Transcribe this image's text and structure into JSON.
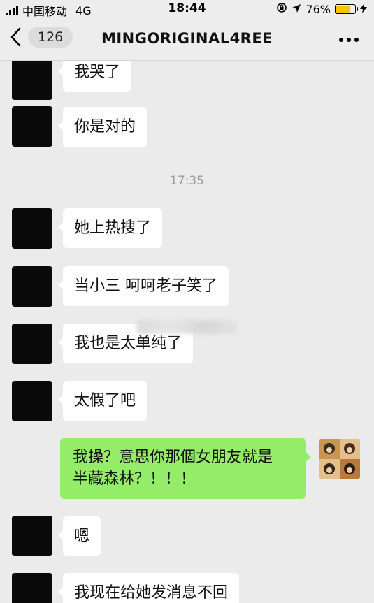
{
  "status_bar": {
    "carrier": "中国移动",
    "network": "4G",
    "time": "18:44",
    "battery": "76%",
    "battery_level": 0.76
  },
  "nav": {
    "back_count": "126",
    "title": "MINGORIGINAL4REE"
  },
  "messages": [
    {
      "side": "left",
      "text": "我哭了"
    },
    {
      "side": "left",
      "text": "你是对的"
    },
    {
      "side": "time",
      "text": "17:35"
    },
    {
      "side": "left",
      "text": "她上热搜了"
    },
    {
      "side": "left",
      "text": "当小三 呵呵老子笑了"
    },
    {
      "side": "left",
      "text": "我也是太单纯了"
    },
    {
      "side": "left",
      "text": "太假了吧"
    },
    {
      "side": "right",
      "text_line1": "我操？意思你那個女朋友就是",
      "text_line2": "半藏森林？！！！"
    },
    {
      "side": "left",
      "text": "嗯"
    },
    {
      "side": "left",
      "text": "我现在给她发消息不回"
    }
  ],
  "colors": {
    "background": "#ebebeb",
    "self_bubble": "#95ec69",
    "other_bubble": "#ffffff",
    "battery": "#f6c400"
  }
}
